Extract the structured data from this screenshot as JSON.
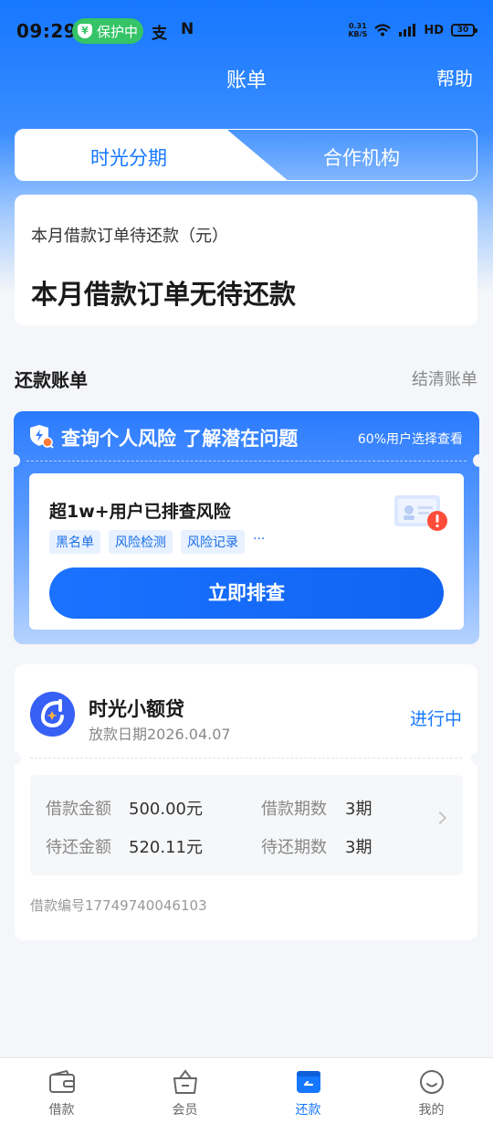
{
  "status_bar": {
    "time": "09:29",
    "protect_label": "保护中",
    "net_speed_value": "0.31",
    "net_speed_unit": "KB/S",
    "network_type": "HD",
    "battery": "30"
  },
  "header": {
    "title": "账单",
    "help": "帮助"
  },
  "tabs": [
    {
      "label": "时光分期",
      "active": true
    },
    {
      "label": "合作机构",
      "active": false
    }
  ],
  "summary": {
    "label": "本月借款订单待还款（元）",
    "value": "本月借款订单无待还款"
  },
  "section": {
    "title": "还款账单",
    "link": "结清账单"
  },
  "risk": {
    "title": "查询个人风险 了解潜在问题",
    "subtitle": "60%用户选择查看",
    "headline": "超1w+用户已排查风险",
    "tags": [
      "黑名单",
      "风险检测",
      "风险记录"
    ],
    "more": "···",
    "button": "立即排查"
  },
  "loan": {
    "name": "时光小额贷",
    "date": "放款日期2026.04.07",
    "status": "进行中",
    "amount_label": "借款金额",
    "amount_value": "500.00元",
    "periods_label": "借款期数",
    "periods_value": "3期",
    "pending_amount_label": "待还金额",
    "pending_amount_value": "520.11元",
    "pending_periods_label": "待还期数",
    "pending_periods_value": "3期",
    "number": "借款编号17749740046103"
  },
  "nav": [
    {
      "label": "借款",
      "icon": "wallet-icon",
      "active": false
    },
    {
      "label": "会员",
      "icon": "basket-icon",
      "active": false
    },
    {
      "label": "还款",
      "icon": "repay-icon",
      "active": true
    },
    {
      "label": "我的",
      "icon": "smile-icon",
      "active": false
    }
  ],
  "colors": {
    "brand": "#1677ff",
    "protect": "#35c467",
    "alert": "#ff4d3a"
  }
}
